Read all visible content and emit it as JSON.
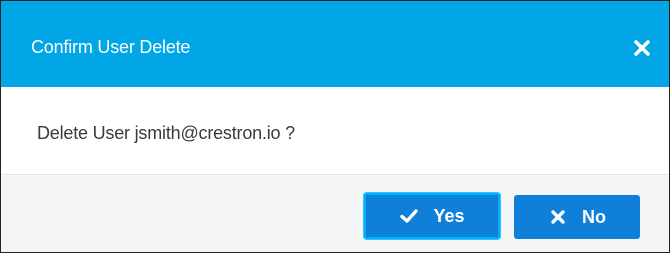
{
  "dialog": {
    "title": "Confirm User Delete",
    "close_icon": "close-icon",
    "message": "Delete User jsmith@crestron.io ?",
    "buttons": {
      "yes_label": "Yes",
      "yes_icon": "check-icon",
      "no_label": "No",
      "no_icon": "x-icon"
    }
  },
  "colors": {
    "header_bg": "#00a6e6",
    "button_bg": "#0f7fd9",
    "footer_bg": "#f4f5f7",
    "text": "#3a3a3a"
  }
}
